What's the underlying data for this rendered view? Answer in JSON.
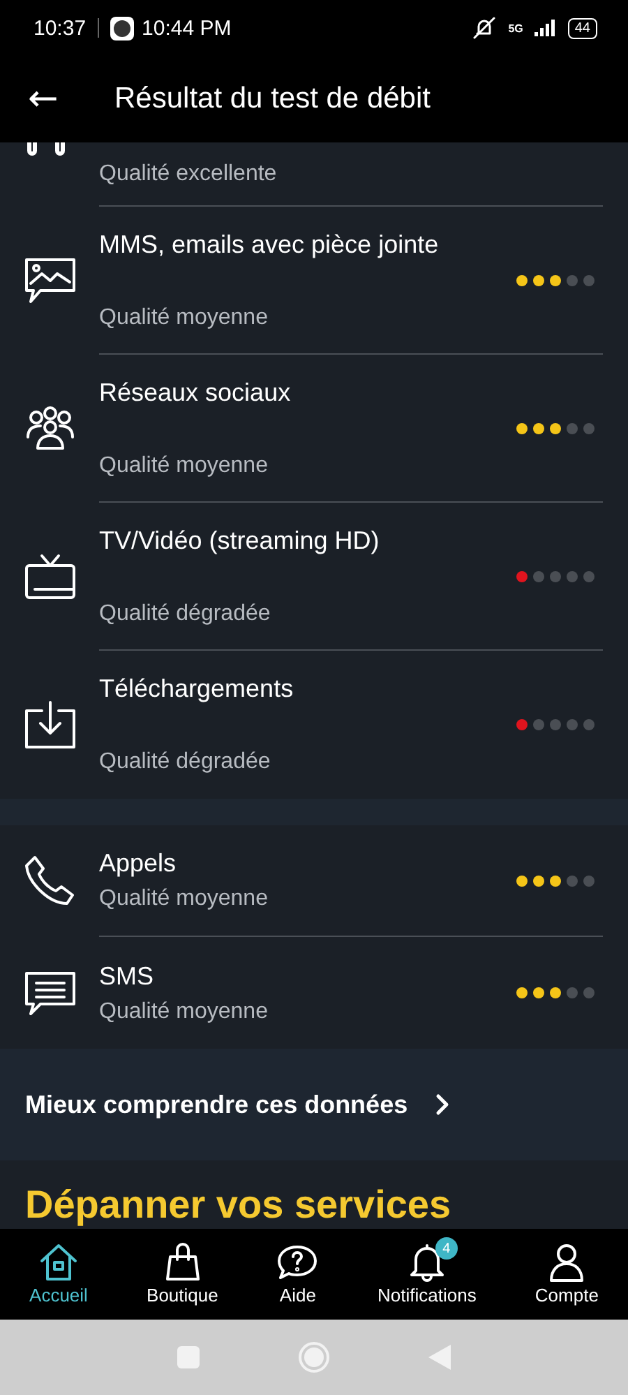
{
  "status_bar": {
    "time": "10:37",
    "clock": "10:44 PM",
    "network": "5G",
    "battery": "44"
  },
  "header": {
    "back": "←",
    "title": "Résultat du test de débit"
  },
  "data_services": {
    "partial_item": {
      "subtitle": "Qualité excellente"
    },
    "items": [
      {
        "kind": "image",
        "title": "MMS, emails avec pièce jointe",
        "subtitle": "Qualité moyenne",
        "stars": 3,
        "color": "#f5c518"
      },
      {
        "kind": "people",
        "title": "Réseaux sociaux",
        "subtitle": "Qualité moyenne",
        "stars": 3,
        "color": "#f5c518"
      },
      {
        "kind": "tv",
        "title": "TV/Vidéo (streaming HD)",
        "subtitle": "Qualité dégradée",
        "stars": 1,
        "color": "#e0141e"
      },
      {
        "kind": "download",
        "title": "Téléchargements",
        "subtitle": "Qualité dégradée",
        "stars": 1,
        "color": "#e0141e"
      }
    ]
  },
  "voice_services": {
    "items": [
      {
        "kind": "phone",
        "title": "Appels",
        "subtitle": "Qualité moyenne",
        "stars": 3,
        "color": "#f5c518"
      },
      {
        "kind": "message",
        "title": "SMS",
        "subtitle": "Qualité moyenne",
        "stars": 3,
        "color": "#f5c518"
      }
    ]
  },
  "link": {
    "label": "Mieux comprendre ces données"
  },
  "section_title": "Dépanner vos services",
  "bottom_nav": [
    {
      "kind": "home",
      "label": "Accueil",
      "selected": true
    },
    {
      "kind": "bag",
      "label": "Boutique",
      "selected": false
    },
    {
      "kind": "help",
      "label": "Aide",
      "selected": false
    },
    {
      "kind": "bell",
      "label": "Notifications",
      "selected": false,
      "badge": "4"
    },
    {
      "kind": "user",
      "label": "Compte",
      "selected": false
    }
  ]
}
